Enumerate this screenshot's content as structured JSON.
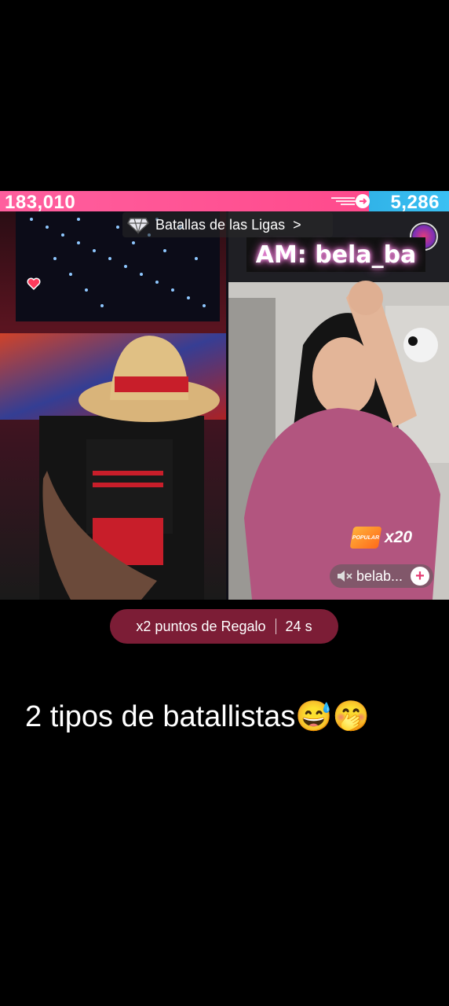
{
  "battle": {
    "left_score": "183,010",
    "right_score": "5,286",
    "league_label": "Batallas de las Ligas",
    "league_chevron": ">"
  },
  "right_stream": {
    "sign_text": "AM: bela_ba",
    "popular_badge": "POPULAR",
    "multiplier": "x20",
    "host_name": "belab...",
    "follow_label": "+"
  },
  "bonus": {
    "label": "x2 puntos de Regalo",
    "timer": "24 s"
  },
  "caption": {
    "text": "2 tipos de batallistas😅🤭"
  },
  "colors": {
    "left_team": "#ff4a8c",
    "right_team": "#3bc0f3",
    "bonus_pill": "#7c1d36"
  },
  "icons": {
    "league": "diamond-trophy-icon",
    "streak": "streak-arrow-icon",
    "heart": "heart-icon",
    "mute": "speaker-muted-icon",
    "gift": "gift-orb-icon"
  }
}
